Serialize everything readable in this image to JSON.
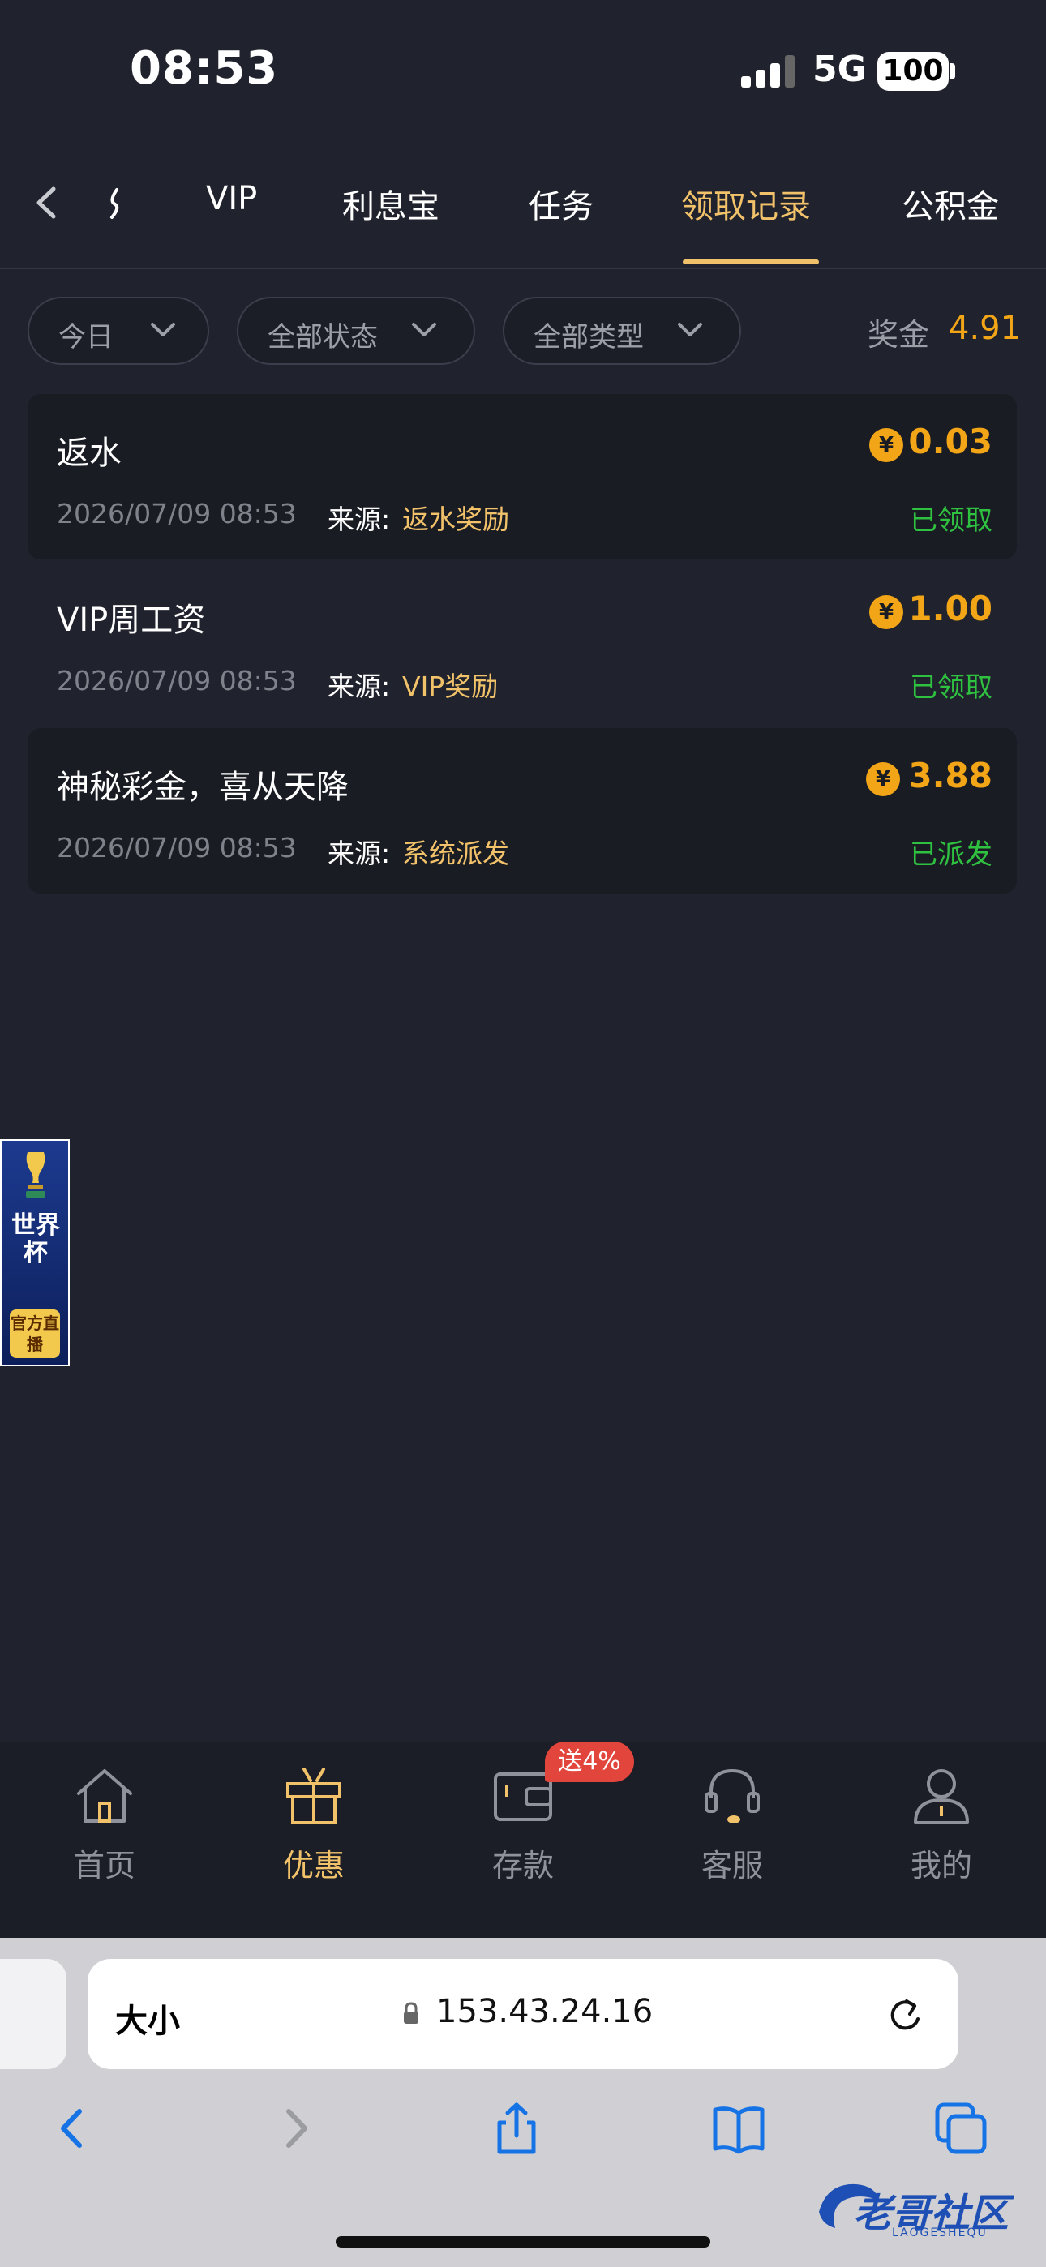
{
  "status_bar": {
    "time": "08:53",
    "network": "5G",
    "battery": "100"
  },
  "tabs": [
    {
      "label": "VIP"
    },
    {
      "label": "利息宝"
    },
    {
      "label": "任务"
    },
    {
      "label": "领取记录",
      "active": true
    },
    {
      "label": "公积金"
    }
  ],
  "filters": {
    "date": "今日",
    "status": "全部状态",
    "type": "全部类型",
    "bonus_label": "奖金",
    "bonus_value": "4.91"
  },
  "records": [
    {
      "title": "返水",
      "datetime": "2026/07/09 08:53",
      "source_label": "来源:",
      "source": "返水奖励",
      "amount": "0.03",
      "status": "已领取"
    },
    {
      "title": "VIP周工资",
      "datetime": "2026/07/09 08:53",
      "source_label": "来源:",
      "source": "VIP奖励",
      "amount": "1.00",
      "status": "已领取"
    },
    {
      "title": "神秘彩金，喜从天降",
      "datetime": "2026/07/09 08:53",
      "source_label": "来源:",
      "source": "系统派发",
      "amount": "3.88",
      "status": "已派发"
    }
  ],
  "currency_symbol": "¥",
  "floating_banner": {
    "title": "世界杯",
    "badge": "官方直播"
  },
  "bottom_nav": [
    {
      "label": "首页",
      "icon": "home-icon"
    },
    {
      "label": "优惠",
      "icon": "gift-icon",
      "active": true
    },
    {
      "label": "存款",
      "icon": "wallet-icon",
      "badge": "送4%"
    },
    {
      "label": "客服",
      "icon": "headset-icon"
    },
    {
      "label": "我的",
      "icon": "user-icon"
    }
  ],
  "browser": {
    "text_size_button": "大小",
    "url": "153.43.24.16"
  },
  "watermark": {
    "text": "老哥社区",
    "sub": "LAOGESHEQU"
  },
  "colors": {
    "accent": "#f2c26b",
    "amount": "#f2a516",
    "success": "#2fc140",
    "background": "#20232d"
  }
}
